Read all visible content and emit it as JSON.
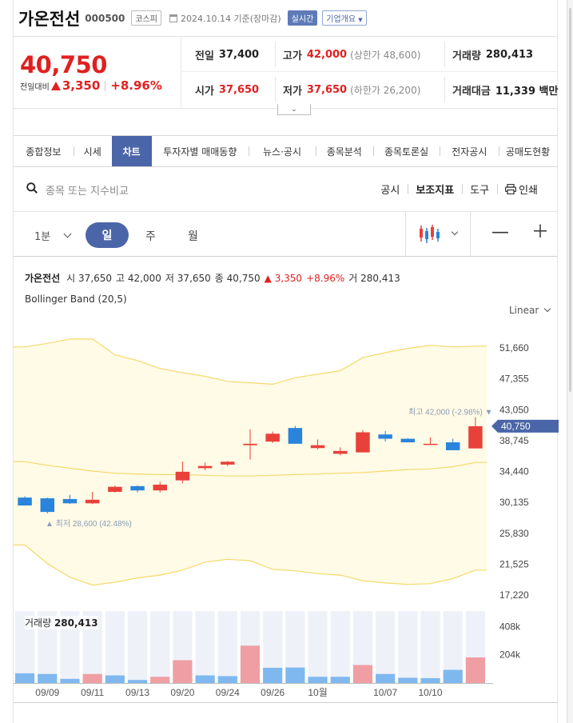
{
  "header": {
    "name": "가온전선",
    "code": "000500",
    "market": "코스피",
    "date_text": "2024.10.14 기준(장마감)",
    "realtime": "실시간",
    "overview": "기업개요"
  },
  "price": {
    "current": "40,750",
    "change_label": "전일대비",
    "change": "3,350",
    "change_pct": "+8.96%",
    "prev_label": "전일",
    "prev": "37,400",
    "high_label": "고가",
    "high": "42,000",
    "upper_limit": "(상한가 48,600)",
    "volume_label": "거래량",
    "volume": "280,413",
    "open_label": "시가",
    "open": "37,650",
    "low_label": "저가",
    "low": "37,650",
    "lower_limit": "(하한가 26,200)",
    "amount_label": "거래대금",
    "amount": "11,339 백만"
  },
  "tabs": [
    "종합정보",
    "시세",
    "차트",
    "투자자별 매매동향",
    "뉴스·공시",
    "종목분석",
    "종목토론실",
    "전자공시",
    "공매도현황"
  ],
  "active_tab": 2,
  "search": {
    "placeholder": "종목 또는 지수비교",
    "tools": [
      "공시",
      "보조지표",
      "도구",
      "인쇄"
    ]
  },
  "period": {
    "minute": "1분",
    "day": "일",
    "week": "주",
    "month": "월"
  },
  "chart_info": {
    "name": "가온전선",
    "open_label": "시",
    "open": "37,650",
    "high_label": "고",
    "high": "42,000",
    "low_label": "저",
    "low": "37,650",
    "close_label": "종",
    "close": "40,750",
    "change": "▲ 3,350",
    "change_pct": "+8.96%",
    "volume_label": "거",
    "volume": "280,413",
    "indicator": "Bollinger Band (20,5)",
    "scale": "Linear",
    "volume_title": "거래량",
    "volume_value": "280,413"
  },
  "chart_data": {
    "type": "candlestick",
    "price_ticks": [
      "51,660",
      "47,355",
      "43,050",
      "38,745",
      "34,440",
      "30,135",
      "25,830",
      "21,525",
      "17,220"
    ],
    "price_tick_values": [
      51660,
      47355,
      43050,
      38745,
      34440,
      30135,
      25830,
      21525,
      17220
    ],
    "current_price": 40750,
    "current_label": "40,750",
    "max_annotation": "최고 42,000 (-2.98%) ▼",
    "min_annotation": "▲ 최저 28,600 (42.48%)",
    "x_labels": [
      {
        "i": 1,
        "label": "09/09"
      },
      {
        "i": 3,
        "label": "09/11"
      },
      {
        "i": 5,
        "label": "09/13"
      },
      {
        "i": 7,
        "label": "09/20"
      },
      {
        "i": 9,
        "label": "09/24"
      },
      {
        "i": 11,
        "label": "09/26"
      },
      {
        "i": 13,
        "label": "10월"
      },
      {
        "i": 16,
        "label": "10/07"
      },
      {
        "i": 18,
        "label": "10/10"
      }
    ],
    "candles": [
      {
        "o": 30800,
        "h": 31000,
        "l": 29700,
        "c": 29700
      },
      {
        "o": 30700,
        "h": 30800,
        "l": 28600,
        "c": 28800
      },
      {
        "o": 30600,
        "h": 31200,
        "l": 29900,
        "c": 30000
      },
      {
        "o": 30000,
        "h": 31600,
        "l": 29900,
        "c": 30500
      },
      {
        "o": 31600,
        "h": 32500,
        "l": 31500,
        "c": 32300
      },
      {
        "o": 32400,
        "h": 32500,
        "l": 31500,
        "c": 31800
      },
      {
        "o": 31800,
        "h": 33000,
        "l": 31500,
        "c": 32600
      },
      {
        "o": 33200,
        "h": 35800,
        "l": 32800,
        "c": 34400
      },
      {
        "o": 34900,
        "h": 35700,
        "l": 34600,
        "c": 35200
      },
      {
        "o": 35400,
        "h": 35900,
        "l": 35200,
        "c": 35800
      },
      {
        "o": 38100,
        "h": 40300,
        "l": 36100,
        "c": 38300
      },
      {
        "o": 38600,
        "h": 40000,
        "l": 38400,
        "c": 39700
      },
      {
        "o": 40500,
        "h": 40800,
        "l": 38300,
        "c": 38300
      },
      {
        "o": 37700,
        "h": 38900,
        "l": 37500,
        "c": 38100
      },
      {
        "o": 36900,
        "h": 37800,
        "l": 36700,
        "c": 37300
      },
      {
        "o": 37100,
        "h": 40200,
        "l": 37100,
        "c": 39900
      },
      {
        "o": 39600,
        "h": 40100,
        "l": 38600,
        "c": 39000
      },
      {
        "o": 39000,
        "h": 39100,
        "l": 38500,
        "c": 38500
      },
      {
        "o": 38300,
        "h": 39200,
        "l": 38200,
        "c": 38300
      },
      {
        "o": 38500,
        "h": 39000,
        "l": 37400,
        "c": 37400
      },
      {
        "o": 37650,
        "h": 42000,
        "l": 37650,
        "c": 40750
      }
    ],
    "bollinger": {
      "upper": [
        51800,
        52300,
        52900,
        52900,
        50700,
        49900,
        48800,
        48200,
        47700,
        47000,
        46800,
        46600,
        47500,
        48000,
        48500,
        50300,
        51000,
        51600,
        52000,
        51800,
        51900
      ],
      "middle": [
        35800,
        35300,
        34900,
        34500,
        34200,
        34100,
        34000,
        34000,
        33900,
        33800,
        33800,
        33900,
        34000,
        34100,
        34200,
        34300,
        34500,
        34700,
        34800,
        35100,
        35700
      ],
      "lower": [
        24200,
        21600,
        19700,
        18600,
        19000,
        19600,
        20000,
        20700,
        21800,
        22200,
        22000,
        20800,
        20600,
        20200,
        20000,
        19200,
        18900,
        18700,
        18800,
        19500,
        20700
      ]
    },
    "volume_ticks": [
      "408k",
      "204k"
    ],
    "volume_tick_values": [
      408000,
      204000
    ],
    "volumes": [
      {
        "v": 70000,
        "up": false
      },
      {
        "v": 65000,
        "up": false
      },
      {
        "v": 30000,
        "up": false
      },
      {
        "v": 65000,
        "up": true
      },
      {
        "v": 55000,
        "up": false
      },
      {
        "v": 22000,
        "up": false
      },
      {
        "v": 45000,
        "up": true
      },
      {
        "v": 165000,
        "up": true
      },
      {
        "v": 55000,
        "up": false
      },
      {
        "v": 50000,
        "up": false
      },
      {
        "v": 270000,
        "up": true
      },
      {
        "v": 110000,
        "up": false
      },
      {
        "v": 112000,
        "up": false
      },
      {
        "v": 45000,
        "up": false
      },
      {
        "v": 45000,
        "up": false
      },
      {
        "v": 130000,
        "up": true
      },
      {
        "v": 65000,
        "up": false
      },
      {
        "v": 38000,
        "up": false
      },
      {
        "v": 35000,
        "up": false
      },
      {
        "v": 95000,
        "up": false
      },
      {
        "v": 185000,
        "up": true
      }
    ],
    "colors": {
      "up": "#e8413a",
      "down": "#2a84db",
      "band": "#f5d96b",
      "band_fill": "#fffbe6",
      "tag": "#4b66a8"
    }
  }
}
